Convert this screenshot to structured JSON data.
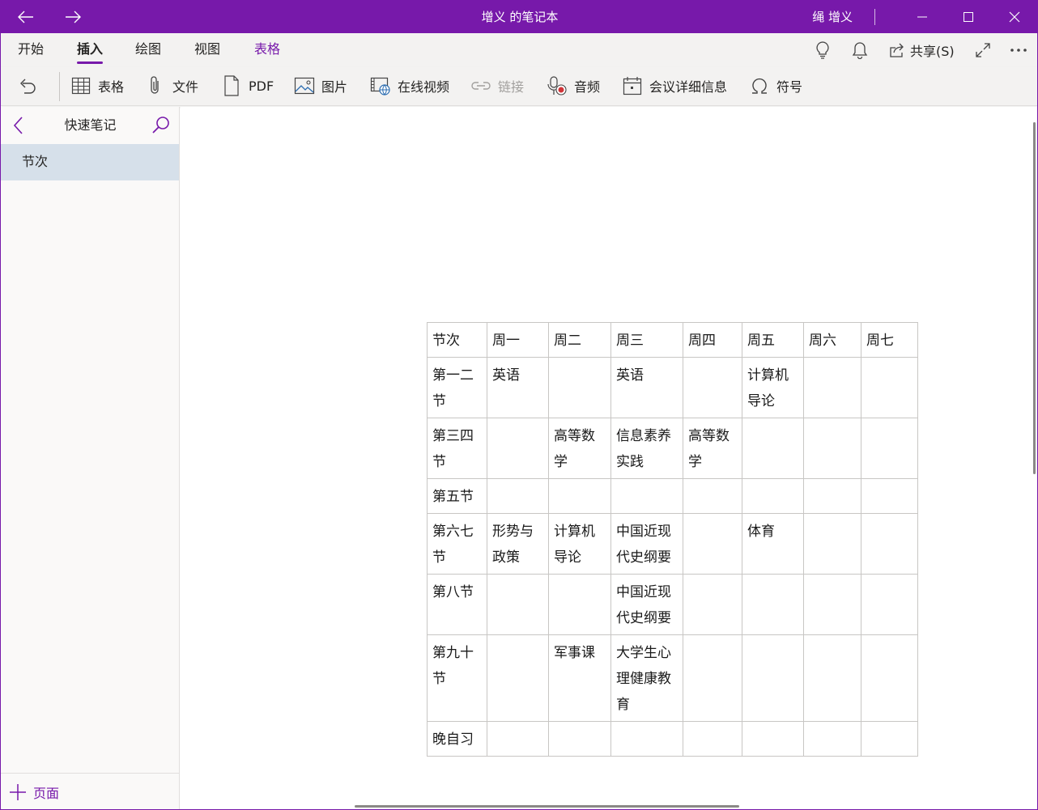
{
  "window": {
    "title": "增义 的笔记本",
    "user": "绳 增义"
  },
  "ribbon_tabs": [
    {
      "label": "开始"
    },
    {
      "label": "插入"
    },
    {
      "label": "绘图"
    },
    {
      "label": "视图"
    },
    {
      "label": "表格"
    }
  ],
  "share_label": "共享(S)",
  "commands": {
    "table": "表格",
    "file": "文件",
    "pdf": "PDF",
    "picture": "图片",
    "online_video": "在线视频",
    "link": "链接",
    "audio": "音频",
    "meeting": "会议详细信息",
    "symbol": "符号"
  },
  "sidebar": {
    "title": "快速笔记",
    "section": "节次",
    "add_page": "页面"
  },
  "timetable": {
    "rows": [
      [
        "节次",
        "周一",
        "周二",
        "周三",
        "周四",
        "周五",
        "周六",
        "周七"
      ],
      [
        "第一二节",
        "英语",
        "",
        "英语",
        "",
        "计算机导论",
        "",
        ""
      ],
      [
        "第三四节",
        "",
        "高等数学",
        "信息素养实践",
        "高等数学",
        "",
        "",
        ""
      ],
      [
        "第五节",
        "",
        "",
        "",
        "",
        "",
        "",
        ""
      ],
      [
        "第六七节",
        "形势与政策",
        "计算机导论",
        "中国近现代史纲要",
        "",
        "体育",
        "",
        ""
      ],
      [
        "第八节",
        "",
        "",
        "中国近现代史纲要",
        "",
        "",
        "",
        ""
      ],
      [
        "第九十节",
        "",
        "军事课",
        "大学生心理健康教育",
        "",
        "",
        "",
        ""
      ],
      [
        "晚自习",
        "",
        "",
        "",
        "",
        "",
        "",
        ""
      ]
    ]
  },
  "colors": {
    "accent": "#7719aa",
    "selected_section": "#d6e0ea",
    "ribbon_bg": "#f3f2f1"
  }
}
